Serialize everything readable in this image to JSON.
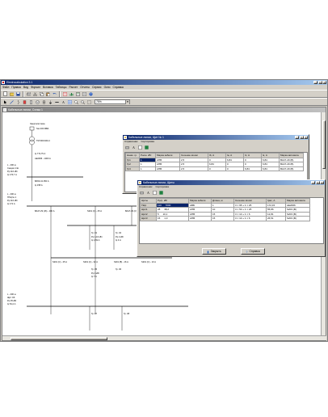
{
  "app": {
    "title": "Electrocalculation 3.1",
    "window_buttons": [
      "_",
      "□",
      "×"
    ]
  },
  "menu": [
    "Файл",
    "Правка",
    "Вид",
    "Формат",
    "Вставка",
    "Таблицы",
    "Расчет",
    "Отчеты",
    "Сервис",
    "Окно",
    "Справка"
  ],
  "toolbar": {
    "row1_icons": [
      "new-icon",
      "open-icon",
      "save-icon",
      "print-icon",
      "cut-icon",
      "copy-icon",
      "paste-icon",
      "undo-icon",
      "table-icon",
      "chart-icon",
      "calc-icon",
      "report-icon",
      "help-icon"
    ],
    "row2_icons": [
      "select-icon",
      "line-icon",
      "switch-icon",
      "breaker-icon",
      "fuse-icon",
      "motor-icon",
      "transformer-icon",
      "load-icon",
      "bus-icon",
      "text-icon",
      "grid-icon",
      "zoom-in-icon",
      "zoom-out-icon",
      "fit-icon"
    ],
    "zoom_value": "75%",
    "combo_arrow": "▼"
  },
  "document": {
    "title": "Кабельные линии, Схема 1"
  },
  "schema": {
    "source": [
      "Энергосистема",
      "Sкз 200 МВА"
    ],
    "transformer": "ТМ 630/10/0,4",
    "cable_in": [
      "Iр 772,75 А",
      "АЕ2066 - 1000 А"
    ],
    "node_left": [
      "L - 400 ш",
      "Секция 1 Ш",
      "Pр 110 кВт",
      "Iр 170,7 А"
    ],
    "tap": [
      "ВА53-41 250 А",
      "Iр 158 А"
    ],
    "node_grsh": [
      "L - 200 ш",
      "ГРЩ № 1",
      "Pр 110 кВт",
      "Iр 171 А"
    ],
    "breakers_row": [
      "ВА47-29 (16) - 100 А",
      "S201 (C) - 25 А",
      "ВА47-29 (С) - 32 А"
    ],
    "branches": [
      "Гр. 01",
      "Гр. 02",
      "Гр. 03",
      "Гр. 04",
      "Гр. 05",
      "Гр. 06",
      "Гр. 07",
      "Гр. 08"
    ],
    "labels": [
      "Pр 1,16 кВт",
      "Iр 1,69 А",
      "Pр 2 кВт",
      "Iр 4 А",
      "Pр 5 кВт",
      "Iр 9 А",
      "Pр 3 кВт",
      "Iр 5 А",
      "Pр 4 кВт",
      "Iр 7 А"
    ],
    "lower_bus": [
      "S201 (C) - 25 А",
      "S201 (C) - 32 А",
      "S201 (B) - 16 А",
      "S201 (C) - 10 А"
    ],
    "lower_left": [
      "L - 200 ш",
      "Щит ОЗ",
      "Pр 35 кВт",
      "Iр 54,2 А"
    ]
  },
  "dialog1": {
    "title": "Кабельные линии, Щит № 1",
    "menu": [
      "Справочник",
      "Сортировка"
    ],
    "columns": [
      "Наим. гр.",
      "Рном. кВт",
      "Марка кабеля",
      "Сечение кв.мм",
      "Ib, А",
      "Ia, А",
      "Ic, А",
      "Iк, А",
      "Марка автомата"
    ],
    "rows": [
      [
        "Гр1",
        "1",
        "АПВ",
        "2,5",
        "0",
        "6,84",
        "0",
        "6,84",
        "ВА47-29 (В)"
      ],
      [
        "Гр2",
        "1",
        "АПВ",
        "2,5",
        "6,84",
        "0",
        "0",
        "6,84",
        "ВА47-29 (В)"
      ],
      [
        "Гр3",
        "1",
        "АПВ",
        "2,5",
        "0",
        "0",
        "6,84",
        "6,84",
        "ВА47-29 (В)"
      ]
    ]
  },
  "dialog2": {
    "title": "Кабельные линии, Щиты",
    "menu": [
      "Справочник",
      "Сортировка"
    ],
    "columns": [
      "Щиты",
      "Рр(c, кВт",
      "Марка кабеля",
      "Длина, м",
      "Сечение кв.мм",
      "Iрас, А",
      "Марка автомата"
    ],
    "rows": [
      [
        "ГЩ1",
        "110",
        "7000",
        "АВБ",
        "1",
        "3 × 95 + 1 × 25",
        "172,15",
        "АЕ2066"
      ],
      [
        "Щит1",
        "28",
        "38,2",
        "АПВ",
        "10",
        "3 × 50 + 1 × 25",
        "55,86",
        "S203 (B)"
      ],
      [
        "Щит2",
        "5",
        "10,1",
        "АПВ",
        "15",
        "3 × 10 + 1 × 6",
        "12,81",
        "S203 (B)"
      ],
      [
        "Щит3",
        "15",
        "1,3",
        "АПВ",
        "15",
        "3 × 10 + 1 × 6",
        "26,51",
        "S203 (B)"
      ]
    ],
    "buttons": [
      "Закрыть",
      "Справка"
    ]
  }
}
